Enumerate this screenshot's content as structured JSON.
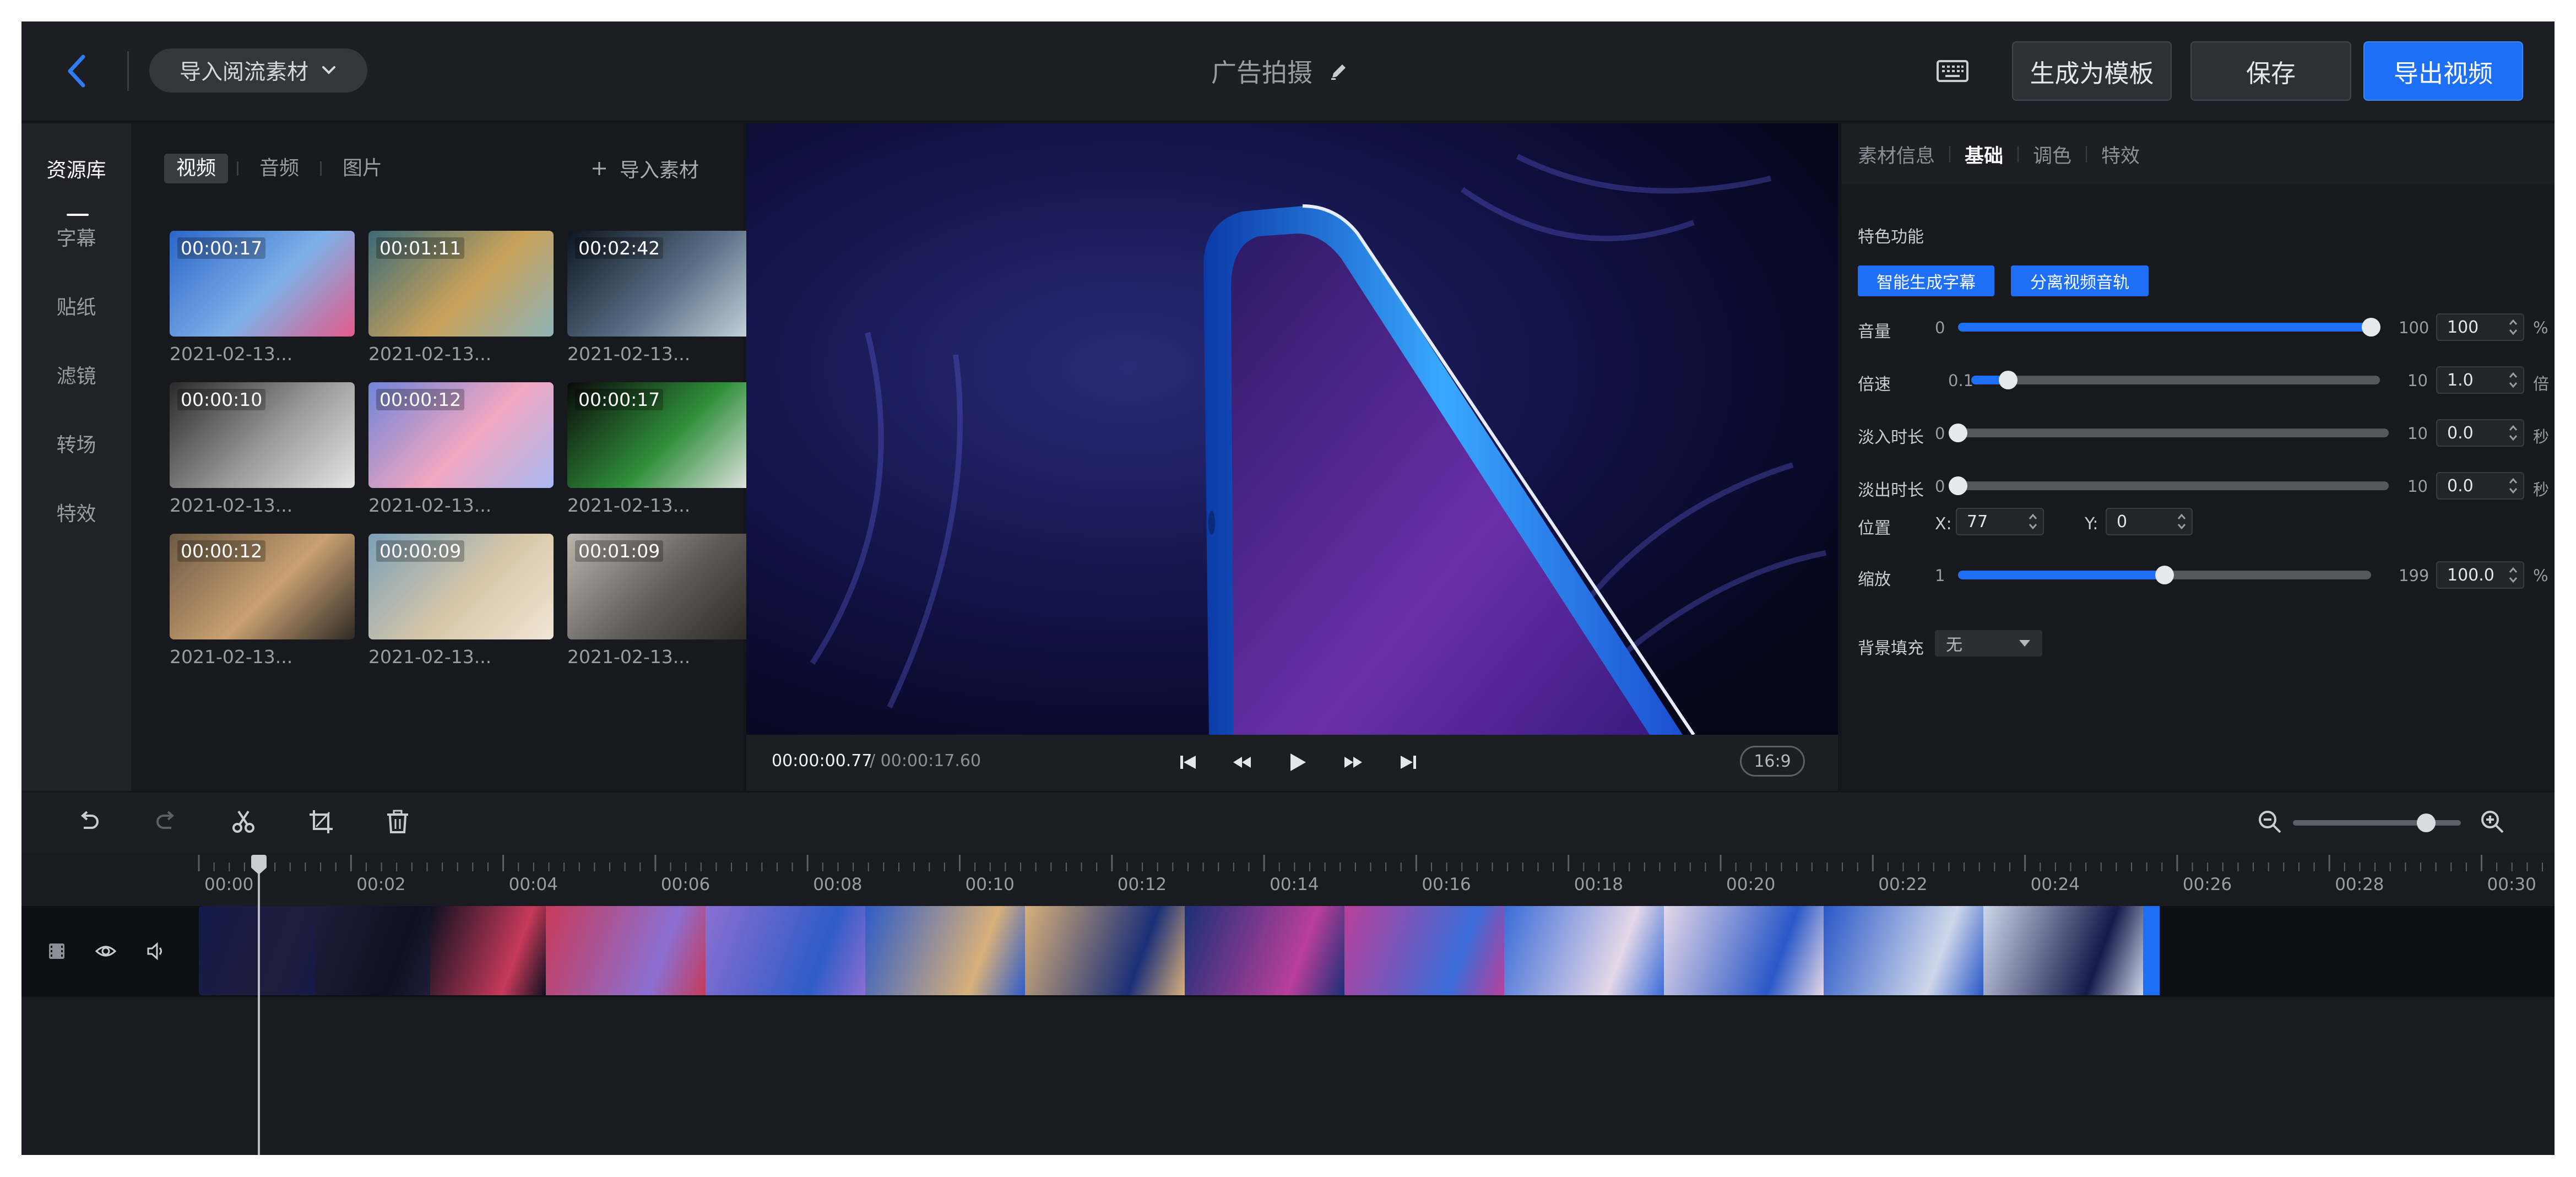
{
  "header": {
    "import_feed_label": "导入阅流素材",
    "project_title": "广告拍摄",
    "make_template_label": "生成为模板",
    "save_label": "保存",
    "export_label": "导出视频"
  },
  "left_nav": {
    "items": [
      {
        "label": "资源库",
        "active": true
      },
      {
        "label": "字幕",
        "active": false
      },
      {
        "label": "贴纸",
        "active": false
      },
      {
        "label": "滤镜",
        "active": false
      },
      {
        "label": "转场",
        "active": false
      },
      {
        "label": "特效",
        "active": false
      }
    ]
  },
  "library": {
    "tabs": [
      {
        "label": "视频",
        "active": true
      },
      {
        "label": "音频",
        "active": false
      },
      {
        "label": "图片",
        "active": false
      }
    ],
    "import_label": "导入素材",
    "items": [
      {
        "duration": "00:00:17",
        "date": "2021-02-13...",
        "colors": [
          "#2b66c9",
          "#7fb0e8",
          "#e35a8a"
        ]
      },
      {
        "duration": "00:01:11",
        "date": "2021-02-13...",
        "colors": [
          "#3b6a78",
          "#c9a25a",
          "#8fb4b8"
        ]
      },
      {
        "duration": "00:02:42",
        "date": "2021-02-13...",
        "colors": [
          "#0d1620",
          "#5a6f86",
          "#c8d4dc"
        ]
      },
      {
        "duration": "00:00:10",
        "date": "2021-02-13...",
        "colors": [
          "#2a2a2a",
          "#9b9b9b",
          "#e6e6e6"
        ]
      },
      {
        "duration": "00:00:12",
        "date": "2021-02-13...",
        "colors": [
          "#6f84d8",
          "#f1a7c0",
          "#a7b8f2"
        ]
      },
      {
        "duration": "00:00:17",
        "date": "2021-02-13...",
        "colors": [
          "#0a0a0a",
          "#2f8f3a",
          "#e6e6e6"
        ]
      },
      {
        "duration": "00:00:12",
        "date": "2021-02-13...",
        "colors": [
          "#6d5a44",
          "#c9a071",
          "#2e2a25"
        ]
      },
      {
        "duration": "00:00:09",
        "date": "2021-02-13...",
        "colors": [
          "#7aa0b8",
          "#d8c7a8",
          "#f0e6d6"
        ]
      },
      {
        "duration": "00:01:09",
        "date": "2021-02-13...",
        "colors": [
          "#b9b4ad",
          "#5d5a57",
          "#2a2724"
        ]
      }
    ]
  },
  "preview": {
    "current_time": "00:00:00.77",
    "total_time": "/ 00:00:17.60",
    "aspect_ratio": "16:9"
  },
  "right_panel": {
    "tabs": [
      {
        "label": "素材信息",
        "active": false
      },
      {
        "label": "基础",
        "active": true
      },
      {
        "label": "调色",
        "active": false
      },
      {
        "label": "特效",
        "active": false
      }
    ],
    "section_title": "特色功能",
    "auto_subtitle_label": "智能生成字幕",
    "split_audio_label": "分离视频音轨",
    "sliders": [
      {
        "label": "音量",
        "min": "0",
        "max": "100",
        "value": "100",
        "unit": "%",
        "fraction": 1.0
      },
      {
        "label": "倍速",
        "min": "0.1",
        "max": "10",
        "value": "1.0",
        "unit": "倍",
        "fraction": 0.09
      },
      {
        "label": "淡入时长",
        "min": "0",
        "max": "10",
        "value": "0.0",
        "unit": "秒",
        "fraction": 0.0
      },
      {
        "label": "淡出时长",
        "min": "0",
        "max": "10",
        "value": "0.0",
        "unit": "秒",
        "fraction": 0.0
      }
    ],
    "position": {
      "label": "位置",
      "x_label": "X:",
      "x_value": "77",
      "y_label": "Y:",
      "y_value": "0"
    },
    "scale": {
      "label": "缩放",
      "min": "1",
      "max": "199",
      "value": "100.0",
      "unit": "%",
      "fraction": 0.5
    },
    "bg_fill": {
      "label": "背景填充",
      "value": "无"
    }
  },
  "timeline": {
    "ticks": [
      "00:00",
      "00:02",
      "00:04",
      "00:06",
      "00:08",
      "00:10",
      "00:12",
      "00:14",
      "00:16",
      "00:18",
      "00:20",
      "00:22",
      "00:24",
      "00:26",
      "00:28",
      "00:30"
    ],
    "playhead_seconds": 0.77,
    "zoom_fraction": 0.78,
    "clip_colors": [
      "#141a4a",
      "#1f1d3a",
      "#0e1020",
      "#c73a5a",
      "#8b6fd2",
      "#2f5cc7",
      "#d8b07a",
      "#1b2f77",
      "#b93f9a",
      "#3a6cd8",
      "#e5d8e8",
      "#2a58c8",
      "#cfd7ea"
    ]
  },
  "colors": {
    "accent": "#1d6ff5",
    "background": "#141519",
    "panel": "#18191e"
  }
}
